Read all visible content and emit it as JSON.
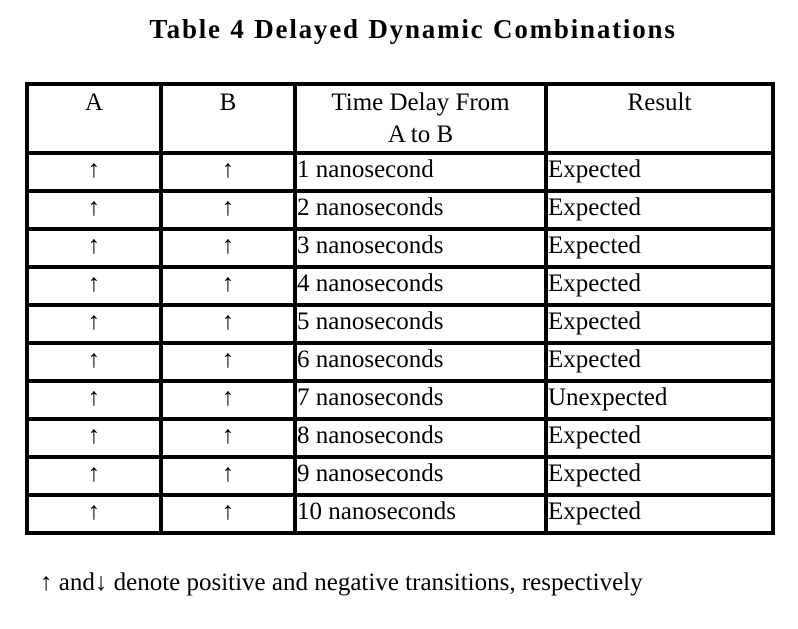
{
  "title": "Table 4  Delayed Dynamic Combinations",
  "table": {
    "headers": [
      "A",
      "B",
      "Time Delay From A to B",
      "Result"
    ],
    "header_lines": {
      "delay_line1": "Time Delay From",
      "delay_line2": "A to B"
    },
    "rows": [
      {
        "a": "↑",
        "b": "↑",
        "delay": "1 nanosecond",
        "result": "Expected"
      },
      {
        "a": "↑",
        "b": "↑",
        "delay": "2 nanoseconds",
        "result": "Expected"
      },
      {
        "a": "↑",
        "b": "↑",
        "delay": "3 nanoseconds",
        "result": "Expected"
      },
      {
        "a": "↑",
        "b": "↑",
        "delay": "4 nanoseconds",
        "result": "Expected"
      },
      {
        "a": "↑",
        "b": "↑",
        "delay": "5 nanoseconds",
        "result": "Expected"
      },
      {
        "a": "↑",
        "b": "↑",
        "delay": "6 nanoseconds",
        "result": "Expected"
      },
      {
        "a": "↑",
        "b": "↑",
        "delay": "7 nanoseconds",
        "result": "Unexpected"
      },
      {
        "a": "↑",
        "b": "↑",
        "delay": "8 nanoseconds",
        "result": "Expected"
      },
      {
        "a": "↑",
        "b": "↑",
        "delay": "9 nanoseconds",
        "result": "Expected"
      },
      {
        "a": "↑",
        "b": "↑",
        "delay": "10 nanoseconds",
        "result": "Expected"
      }
    ]
  },
  "footnote": "↑ and↓ denote positive and negative transitions, respectively"
}
